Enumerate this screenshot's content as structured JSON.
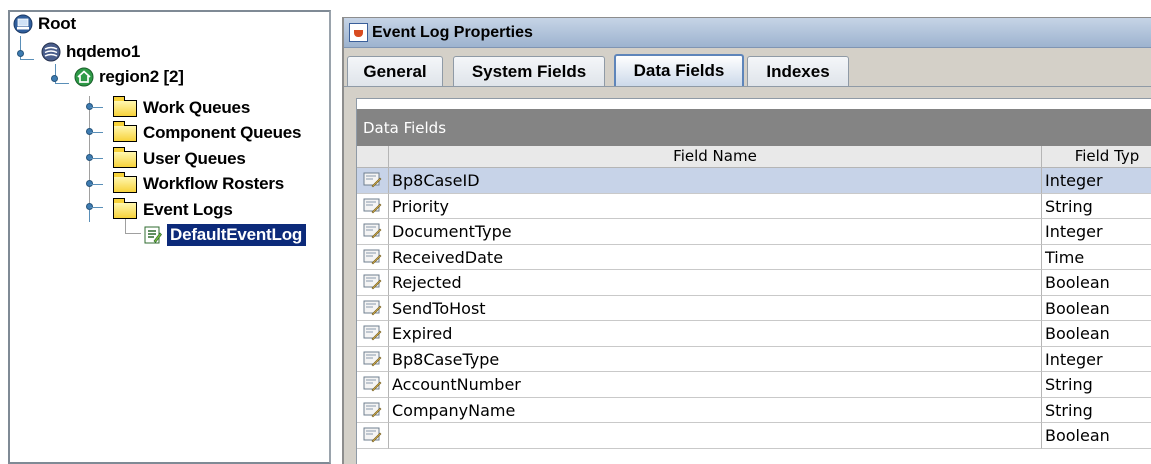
{
  "tree": {
    "nodes": [
      {
        "label": "Root",
        "icon": "root-icon"
      },
      {
        "label": "hqdemo1",
        "icon": "server-icon"
      },
      {
        "label": "region2 [2]",
        "icon": "region-icon"
      },
      {
        "label": "Work Queues",
        "icon": "folder-icon"
      },
      {
        "label": "Component Queues",
        "icon": "folder-icon"
      },
      {
        "label": "User Queues",
        "icon": "folder-icon"
      },
      {
        "label": "Workflow Rosters",
        "icon": "folder-icon"
      },
      {
        "label": "Event Logs",
        "icon": "folder-icon"
      },
      {
        "label": "DefaultEventLog",
        "icon": "event-log-icon",
        "selected": true
      }
    ]
  },
  "window": {
    "title": "Event Log Properties",
    "icon": "java-cup-icon"
  },
  "tabs": [
    {
      "label": "General"
    },
    {
      "label": "System Fields"
    },
    {
      "label": "Data Fields",
      "active": true
    },
    {
      "label": "Indexes"
    }
  ],
  "data_fields": {
    "section_title": "Data Fields",
    "columns": [
      "Field Name",
      "Field Typ"
    ],
    "rows": [
      {
        "name": "Bp8CaseID",
        "type": "Integer",
        "selected": true
      },
      {
        "name": "Priority",
        "type": "String"
      },
      {
        "name": "DocumentType",
        "type": "Integer"
      },
      {
        "name": "ReceivedDate",
        "type": "Time"
      },
      {
        "name": "Rejected",
        "type": "Boolean"
      },
      {
        "name": "SendToHost",
        "type": "Boolean"
      },
      {
        "name": "Expired",
        "type": "Boolean"
      },
      {
        "name": "Bp8CaseType",
        "type": "Integer"
      },
      {
        "name": "AccountNumber",
        "type": "String"
      },
      {
        "name": "CompanyName",
        "type": "String"
      },
      {
        "name": "",
        "type": "Boolean"
      }
    ]
  },
  "colors": {
    "selection": "#0c2a7a",
    "row_selected": "#c7d3e8",
    "section_header": "#848484"
  }
}
